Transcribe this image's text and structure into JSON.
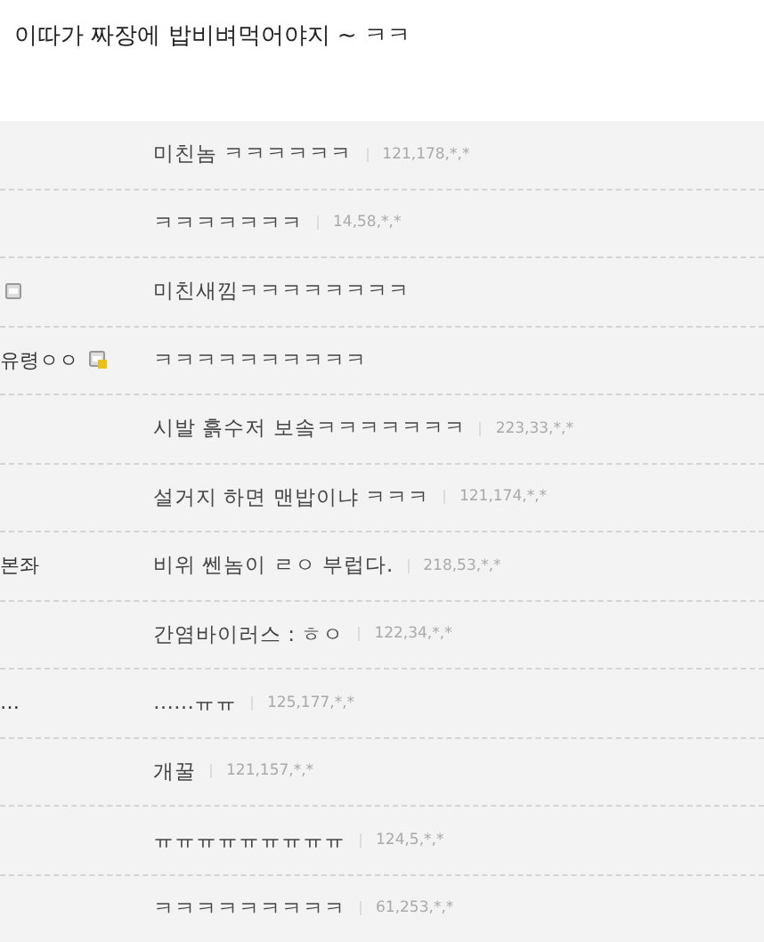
{
  "post": {
    "text": "이따가 짜장에 밥비벼먹어야지 ~ ㅋㅋ"
  },
  "comments": [
    {
      "text": "미친놈 ㅋㅋㅋㅋㅋㅋ",
      "ip": "121,178,*,*"
    },
    {
      "text": "ㅋㅋㅋㅋㅋㅋㅋ",
      "ip": "14,58,*,*"
    },
    {
      "nick_icon": true,
      "nick_icon_flagged": false,
      "text": "미친새낌ㅋㅋㅋㅋㅋㅋㅋㅋ"
    },
    {
      "nickname": "유령ㅇㅇ",
      "nick_icon": true,
      "nick_icon_flagged": true,
      "text": "ㅋㅋㅋㅋㅋㅋㅋㅋㅋㅋ"
    },
    {
      "text": "시발 흙수저 보솤ㅋㅋㅋㅋㅋㅋㅋ",
      "ip": "223,33,*,*"
    },
    {
      "text": "설거지 하면 맨밥이냐 ㅋㅋㅋ",
      "ip": "121,174,*,*"
    },
    {
      "nickname": "본좌",
      "text": "비위 쎈놈이 ㄹㅇ 부럽다.",
      "ip": "218,53,*,*"
    },
    {
      "text": "간염바이러스 : ㅎㅇ",
      "ip": "122,34,*,*"
    },
    {
      "nickname": "…",
      "text": "……ㅠㅠ",
      "ip": "125,177,*,*"
    },
    {
      "text": "개꿀",
      "ip": "121,157,*,*"
    },
    {
      "text": "ㅠㅠㅠㅠㅠㅠㅠㅠㅠ",
      "ip": "124,5,*,*"
    },
    {
      "text": "ㅋㅋㅋㅋㅋㅋㅋㅋㅋ",
      "ip": "61,253,*,*"
    }
  ]
}
